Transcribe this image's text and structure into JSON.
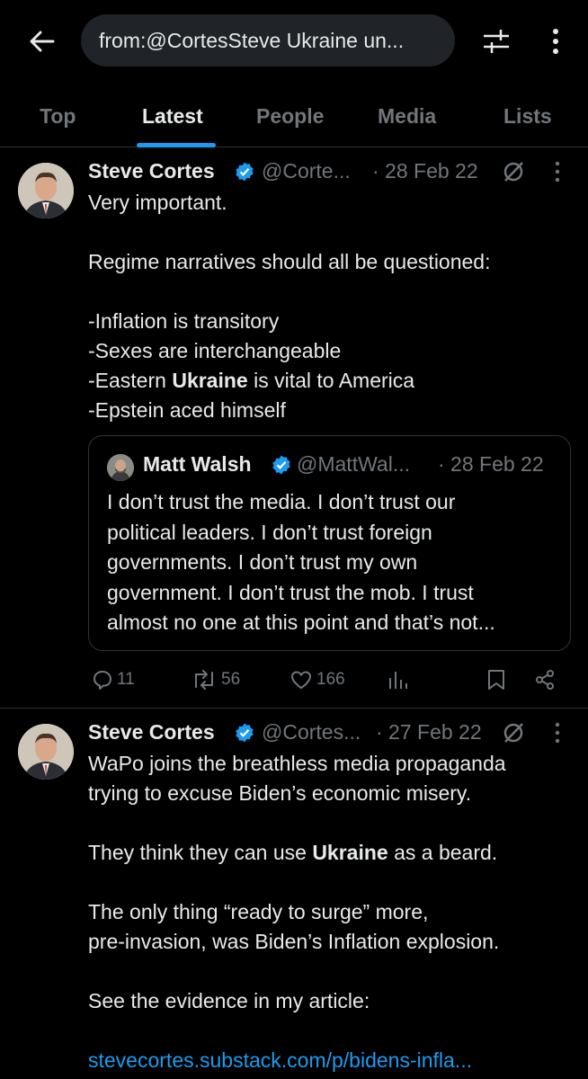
{
  "search": {
    "query": "from:@CortesSteve Ukraine un..."
  },
  "tabs": [
    {
      "label": "Top"
    },
    {
      "label": "Latest"
    },
    {
      "label": "People"
    },
    {
      "label": "Media"
    },
    {
      "label": "Lists"
    }
  ],
  "active_tab": "Latest",
  "tweets": [
    {
      "name": "Steve Cortes",
      "handle": "@Corte...",
      "date": "· 28 Feb 22",
      "lines": [
        "Very important.",
        "",
        "Regime narratives should all be questioned:",
        "",
        "-Inflation is transitory",
        "-Sexes are interchangeable",
        "-Eastern ",
        "-Epstein aced himself"
      ],
      "bold_word": "Ukraine",
      "line6_suffix": " is vital to America",
      "quote": {
        "name": "Matt Walsh",
        "handle": "@MattWal...",
        "date": "· 28 Feb 22",
        "lines": [
          "I don’t trust the media. I don’t trust our",
          "political leaders. I don’t trust foreign",
          "governments. I don’t trust my own",
          "government. I don’t trust the mob. I trust",
          "almost no one at this point and that’s not..."
        ]
      },
      "stats": {
        "replies": "11",
        "retweets": "56",
        "likes": "166"
      }
    },
    {
      "name": "Steve Cortes",
      "handle": "@Cortes...",
      "date": "· 27 Feb 22",
      "line1": "WaPo joins the breathless media propaganda",
      "line2": "trying to excuse Biden’s economic misery.",
      "line3_prefix": "They think they can use ",
      "bold_word": "Ukraine",
      "line3_suffix": " as a beard.",
      "line4": "The only thing “ready to surge” more,",
      "line5": "pre-invasion, was Biden’s Inflation explosion.",
      "line6": "See the evidence in my article:",
      "link": "stevecortes.substack.com/p/bidens-infla..."
    }
  ],
  "colors": {
    "accent": "#1d9bf0",
    "muted": "#71767b",
    "text": "#e7e9ea",
    "background": "#000000"
  }
}
